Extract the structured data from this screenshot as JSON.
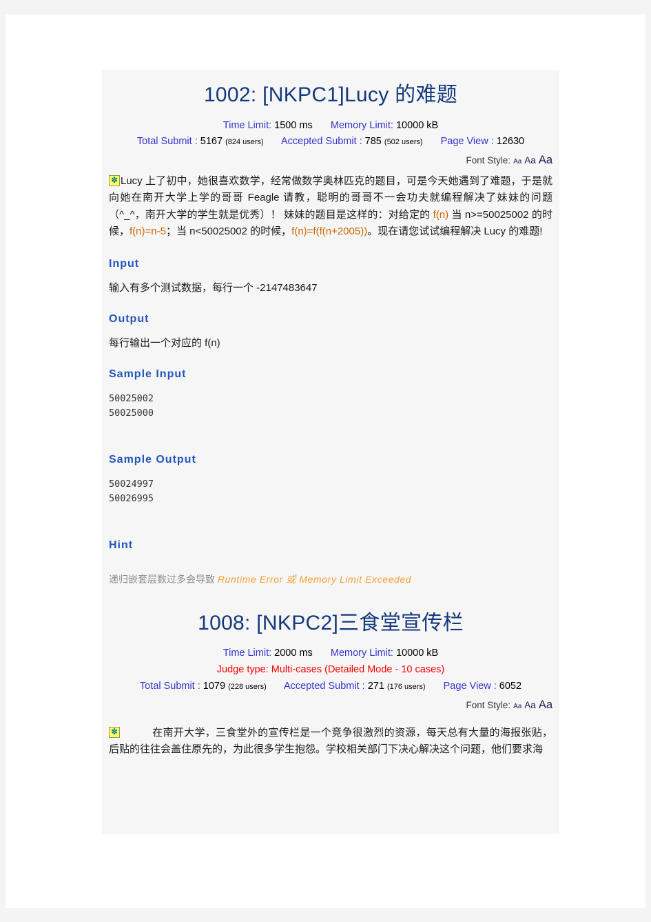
{
  "problems": [
    {
      "title": "1002: [NKPC1]Lucy 的难题",
      "time_limit_label": "Time Limit:",
      "time_limit_value": "1500 ms",
      "memory_limit_label": "Memory Limit:",
      "memory_limit_value": "10000 kB",
      "judge_type": "",
      "total_submit_label": "Total Submit :",
      "total_submit_value": "5167",
      "total_submit_users": "(824 users)",
      "accepted_label": "Accepted Submit :",
      "accepted_value": "785",
      "accepted_users": "(502 users)",
      "page_view_label": "Page View :",
      "page_view_value": "12630",
      "font_style_label": "Font Style:",
      "font_style_options": [
        "Aa",
        "Aa",
        "Aa"
      ],
      "description_parts": [
        {
          "text": "Lucy 上了初中，她很喜欢数学，经常做数学奥林匹克的题目，可是今天她遇到了难题，于是就向她在南开大学上学的哥哥 Feagle 请教，聪明的哥哥不一会功夫就编程解决了妹妹的问题（^_^，南开大学的学生就是优秀）！ 妹妹的题目是这样的：对给定的 ",
          "style": "plain"
        },
        {
          "text": "f(n)",
          "style": "code"
        },
        {
          "text": " 当 n>=50025002 的时候，",
          "style": "plain"
        },
        {
          "text": "f(n)=n-5",
          "style": "code"
        },
        {
          "text": "；当 n<50025002 的时候，",
          "style": "plain"
        },
        {
          "text": "f(n)=f(f(n+2005))",
          "style": "code"
        },
        {
          "text": "。现在请您试试编程解决 Lucy 的难题!",
          "style": "plain"
        }
      ],
      "sections": [
        {
          "heading": "Input",
          "body": "输入有多个测试数据，每行一个 -2147483647",
          "type": "text"
        },
        {
          "heading": "Output",
          "body": "每行输出一个对应的 f(n)",
          "type": "text"
        },
        {
          "heading": "Sample Input",
          "body": "50025002\n50025000",
          "type": "code"
        },
        {
          "heading": "Sample Output",
          "body": "50024997\n50026995",
          "type": "code"
        }
      ],
      "hint": {
        "heading": "Hint",
        "plain": "递归嵌套层数过多会导致 ",
        "emphasis": "Runtime Error 或 Memory Limit Exceeded"
      }
    },
    {
      "title": "1008: [NKPC2]三食堂宣传栏",
      "time_limit_label": "Time Limit:",
      "time_limit_value": "2000 ms",
      "memory_limit_label": "Memory Limit:",
      "memory_limit_value": "10000 kB",
      "judge_type": "Judge type: Multi-cases (Detailed Mode - 10 cases)",
      "total_submit_label": "Total Submit :",
      "total_submit_value": "1079",
      "total_submit_users": "(228 users)",
      "accepted_label": "Accepted Submit :",
      "accepted_value": "271",
      "accepted_users": "(176 users)",
      "page_view_label": "Page View :",
      "page_view_value": "6052",
      "font_style_label": "Font Style:",
      "font_style_options": [
        "Aa",
        "Aa",
        "Aa"
      ],
      "description": "在南开大学，三食堂外的宣传栏是一个竞争很激烈的资源，每天总有大量的海报张贴，后贴的往往会盖住原先的，为此很多学生抱怨。学校相关部门下决心解决这个问题，他们要求海"
    }
  ],
  "icons": {
    "pin": "pin-icon"
  },
  "colors": {
    "title": "#14397d",
    "section_heading": "#2255bb",
    "meta_label": "#3333cc",
    "judge_type": "#ff0000",
    "code_fragment": "#cc6600",
    "hint_emphasis": "#f5a033",
    "panel_bg": "#f6f6f6",
    "page_bg": "#ffffff",
    "outer_bg": "#f4f4f4"
  }
}
